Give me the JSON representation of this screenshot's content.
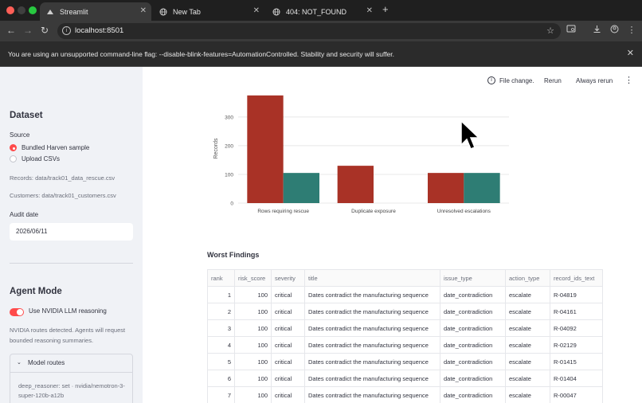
{
  "browser": {
    "tabs": [
      {
        "label": "Streamlit",
        "active": true,
        "icon": "streamlit-icon"
      },
      {
        "label": "New Tab",
        "active": false,
        "icon": "globe-icon"
      },
      {
        "label": "404: NOT_FOUND",
        "active": false,
        "icon": "globe-icon"
      }
    ],
    "url": "localhost:8501",
    "warning": "You are using an unsupported command-line flag: --disable-blink-features=AutomationControlled. Stability and security will suffer."
  },
  "sidebar": {
    "dataset_heading": "Dataset",
    "source_label": "Source",
    "source_options": [
      "Bundled Harven sample",
      "Upload CSVs"
    ],
    "source_selected": "Bundled Harven sample",
    "records_path": "Records: data/track01_data_rescue.csv",
    "customers_path": "Customers: data/track01_customers.csv",
    "audit_date_label": "Audit date",
    "audit_date_value": "2026/06/11",
    "agent_mode_heading": "Agent Mode",
    "toggle_label": "Use NVIDIA LLM reasoning",
    "toggle_on": true,
    "routes_notice": "NVIDIA routes detected. Agents will request bounded reasoning summaries.",
    "expander_title": "Model routes",
    "expander_body": "deep_reasoner: set · nvidia/nemotron-3-super-120b-a12b"
  },
  "status_bar": {
    "file_change": "File change.",
    "rerun": "Rerun",
    "always_rerun": "Always rerun"
  },
  "chart_data": {
    "type": "bar",
    "categories": [
      "Rows requiring rescue",
      "Duplicate exposure",
      "Unresolved escalations"
    ],
    "series": [
      {
        "color": "#a93226",
        "values": [
          375,
          130,
          105
        ]
      },
      {
        "color": "#2e7d74",
        "values": [
          105,
          0,
          105
        ]
      }
    ],
    "ylabel": "Records",
    "ylim": [
      0,
      380
    ],
    "yticks": [
      0,
      100,
      200,
      300
    ],
    "grid": true
  },
  "findings": {
    "title": "Worst Findings",
    "columns": [
      "rank",
      "risk_score",
      "severity",
      "title",
      "issue_type",
      "action_type",
      "record_ids_text"
    ],
    "rows": [
      [
        "1",
        "100",
        "critical",
        "Dates contradict the manufacturing sequence",
        "date_contradiction",
        "escalate",
        "R-04819"
      ],
      [
        "2",
        "100",
        "critical",
        "Dates contradict the manufacturing sequence",
        "date_contradiction",
        "escalate",
        "R-04161"
      ],
      [
        "3",
        "100",
        "critical",
        "Dates contradict the manufacturing sequence",
        "date_contradiction",
        "escalate",
        "R-04092"
      ],
      [
        "4",
        "100",
        "critical",
        "Dates contradict the manufacturing sequence",
        "date_contradiction",
        "escalate",
        "R-02129"
      ],
      [
        "5",
        "100",
        "critical",
        "Dates contradict the manufacturing sequence",
        "date_contradiction",
        "escalate",
        "R-01415"
      ],
      [
        "6",
        "100",
        "critical",
        "Dates contradict the manufacturing sequence",
        "date_contradiction",
        "escalate",
        "R-01404"
      ],
      [
        "7",
        "100",
        "critical",
        "Dates contradict the manufacturing sequence",
        "date_contradiction",
        "escalate",
        "R-00047"
      ]
    ]
  }
}
